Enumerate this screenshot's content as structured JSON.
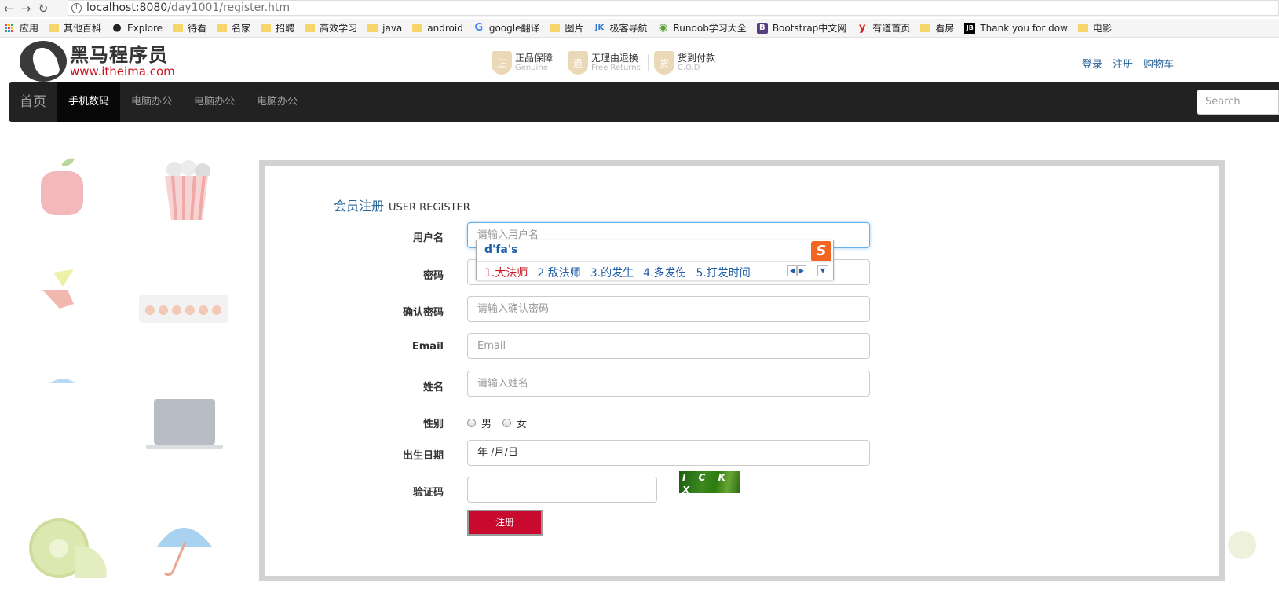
{
  "browser": {
    "url_host": "localhost:8080",
    "url_path": "/day1001/register.htm",
    "back_icon": "arrow-left-icon",
    "forward_icon": "arrow-right-icon",
    "reload_icon": "reload-icon"
  },
  "bookmarks": [
    {
      "label": "应用",
      "icon": "apps-grid-icon"
    },
    {
      "label": "其他百科",
      "icon": "folder-icon"
    },
    {
      "label": "Explore",
      "icon": "github-icon"
    },
    {
      "label": "待看",
      "icon": "folder-icon"
    },
    {
      "label": "名家",
      "icon": "folder-icon"
    },
    {
      "label": "招聘",
      "icon": "folder-icon"
    },
    {
      "label": "高效学习",
      "icon": "folder-icon"
    },
    {
      "label": "java",
      "icon": "folder-icon"
    },
    {
      "label": "android",
      "icon": "folder-icon"
    },
    {
      "label": "google翻译",
      "icon": "google-icon"
    },
    {
      "label": "图片",
      "icon": "folder-icon"
    },
    {
      "label": "极客导航",
      "icon": "jk-icon"
    },
    {
      "label": "Runoob学习大全",
      "icon": "runoob-icon"
    },
    {
      "label": "Bootstrap中文网",
      "icon": "bootstrap-icon"
    },
    {
      "label": "有道首页",
      "icon": "youdao-icon"
    },
    {
      "label": "看房",
      "icon": "folder-icon"
    },
    {
      "label": "Thank you for dow",
      "icon": "jetbrains-icon"
    },
    {
      "label": "电影",
      "icon": "folder-icon"
    }
  ],
  "header": {
    "brand_cn": "黑马程序员",
    "brand_url": "www.itheima.com",
    "guarantees": [
      {
        "title": "正品保障",
        "sub": "Genuine",
        "glyph": "正"
      },
      {
        "title": "无理由退换",
        "sub": "Free Returns",
        "glyph": "退"
      },
      {
        "title": "货到付款",
        "sub": "C.O.D",
        "glyph": "货"
      }
    ],
    "links": {
      "login": "登录",
      "register": "注册",
      "cart": "购物车"
    }
  },
  "navbar": {
    "home": "首页",
    "items": [
      "手机数码",
      "电脑办公",
      "电脑办公",
      "电脑办公"
    ],
    "active_index": 0,
    "search_placeholder": "Search"
  },
  "register": {
    "title_cn": "会员注册",
    "title_en": "USER REGISTER",
    "fields": {
      "username": {
        "label": "用户名",
        "placeholder": "请输入用户名"
      },
      "password": {
        "label": "密码",
        "placeholder": "请输入密码"
      },
      "confirm": {
        "label": "确认密码",
        "placeholder": "请输入确认密码"
      },
      "email": {
        "label": "Email",
        "placeholder": "Email"
      },
      "name": {
        "label": "姓名",
        "placeholder": "请输入姓名"
      },
      "gender": {
        "label": "性别",
        "options": [
          "男",
          "女"
        ]
      },
      "birthday": {
        "label": "出生日期",
        "value": "年 /月/日"
      },
      "captcha": {
        "label": "验证码",
        "value": "",
        "image_text": "I C K X"
      }
    },
    "submit_label": "注册"
  },
  "ime": {
    "composition": "d'fa's",
    "candidates": [
      "1.大法师",
      "2.敌法师",
      "3.的发生",
      "4.多发伤",
      "5.打发时间"
    ],
    "logo": "S"
  }
}
